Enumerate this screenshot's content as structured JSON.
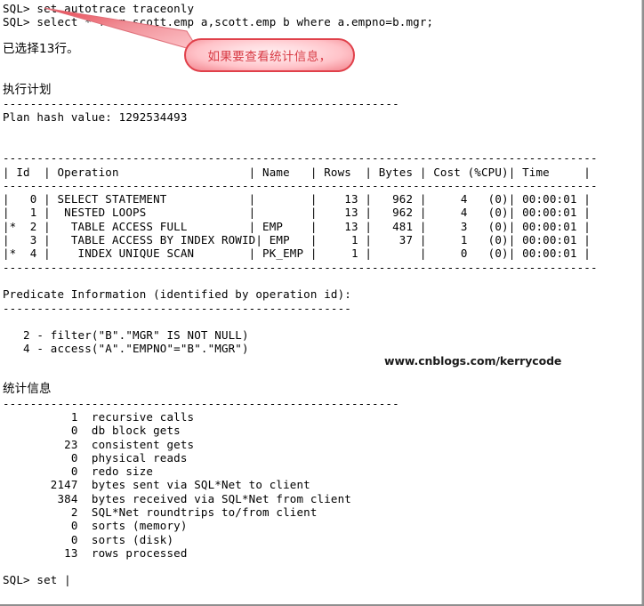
{
  "terminal": {
    "prompt": "SQL>",
    "lines": [
      {
        "type": "text",
        "text": "SQL> set autotrace traceonly"
      },
      {
        "type": "text",
        "text": "SQL> select * from scott.emp a,scott.emp b where a.empno=b.mgr;"
      },
      {
        "type": "blank",
        "text": ""
      },
      {
        "type": "cn",
        "text": "已选择13行。"
      },
      {
        "type": "blank",
        "text": ""
      },
      {
        "type": "blank",
        "text": ""
      },
      {
        "type": "cn",
        "text": "执行计划"
      },
      {
        "type": "text",
        "text": "----------------------------------------------------------"
      },
      {
        "type": "text",
        "text": "Plan hash value: 1292534493"
      },
      {
        "type": "blank",
        "text": ""
      },
      {
        "type": "blank",
        "text": ""
      },
      {
        "type": "text",
        "text": "---------------------------------------------------------------------------------------"
      },
      {
        "type": "text",
        "text": "| Id  | Operation                   | Name   | Rows  | Bytes | Cost (%CPU)| Time     |"
      },
      {
        "type": "text",
        "text": "---------------------------------------------------------------------------------------"
      },
      {
        "type": "text",
        "text": "|   0 | SELECT STATEMENT            |        |    13 |   962 |     4   (0)| 00:00:01 |"
      },
      {
        "type": "text",
        "text": "|   1 |  NESTED LOOPS               |        |    13 |   962 |     4   (0)| 00:00:01 |"
      },
      {
        "type": "text",
        "text": "|*  2 |   TABLE ACCESS FULL         | EMP    |    13 |   481 |     3   (0)| 00:00:01 |"
      },
      {
        "type": "text",
        "text": "|   3 |   TABLE ACCESS BY INDEX ROWID| EMP   |     1 |    37 |     1   (0)| 00:00:01 |"
      },
      {
        "type": "text",
        "text": "|*  4 |    INDEX UNIQUE SCAN        | PK_EMP |     1 |       |     0   (0)| 00:00:01 |"
      },
      {
        "type": "text",
        "text": "---------------------------------------------------------------------------------------"
      },
      {
        "type": "blank",
        "text": ""
      },
      {
        "type": "text",
        "text": "Predicate Information (identified by operation id):"
      },
      {
        "type": "text",
        "text": "---------------------------------------------------"
      },
      {
        "type": "blank",
        "text": ""
      },
      {
        "type": "text",
        "text": "   2 - filter(\"B\".\"MGR\" IS NOT NULL)"
      },
      {
        "type": "text",
        "text": "   4 - access(\"A\".\"EMPNO\"=\"B\".\"MGR\")"
      },
      {
        "type": "blank",
        "text": ""
      },
      {
        "type": "blank",
        "text": ""
      },
      {
        "type": "cn",
        "text": "统计信息"
      },
      {
        "type": "text",
        "text": "----------------------------------------------------------"
      },
      {
        "type": "text",
        "text": "          1  recursive calls"
      },
      {
        "type": "text",
        "text": "          0  db block gets"
      },
      {
        "type": "text",
        "text": "         23  consistent gets"
      },
      {
        "type": "text",
        "text": "          0  physical reads"
      },
      {
        "type": "text",
        "text": "          0  redo size"
      },
      {
        "type": "text",
        "text": "       2147  bytes sent via SQL*Net to client"
      },
      {
        "type": "text",
        "text": "        384  bytes received via SQL*Net from client"
      },
      {
        "type": "text",
        "text": "          2  SQL*Net roundtrips to/from client"
      },
      {
        "type": "text",
        "text": "          0  sorts (memory)"
      },
      {
        "type": "text",
        "text": "          0  sorts (disk)"
      },
      {
        "type": "text",
        "text": "         13  rows processed"
      },
      {
        "type": "blank",
        "text": ""
      },
      {
        "type": "text",
        "text": "SQL> set |"
      }
    ]
  },
  "plan": {
    "headers": [
      "Id",
      "Operation",
      "Name",
      "Rows",
      "Bytes",
      "Cost (%CPU)",
      "Time"
    ],
    "hash_value": "1292534493",
    "rows": [
      {
        "id": "0",
        "star": "",
        "operation": "SELECT STATEMENT",
        "name": "",
        "rows": "13",
        "bytes": "962",
        "cost": "4   (0)",
        "time": "00:00:01"
      },
      {
        "id": "1",
        "star": "",
        "operation": "NESTED LOOPS",
        "name": "",
        "rows": "13",
        "bytes": "962",
        "cost": "4   (0)",
        "time": "00:00:01"
      },
      {
        "id": "2",
        "star": "*",
        "operation": "TABLE ACCESS FULL",
        "name": "EMP",
        "rows": "13",
        "bytes": "481",
        "cost": "3   (0)",
        "time": "00:00:01"
      },
      {
        "id": "3",
        "star": "",
        "operation": "TABLE ACCESS BY INDEX ROWID",
        "name": "EMP",
        "rows": "1",
        "bytes": "37",
        "cost": "1   (0)",
        "time": "00:00:01"
      },
      {
        "id": "4",
        "star": "*",
        "operation": "INDEX UNIQUE SCAN",
        "name": "PK_EMP",
        "rows": "1",
        "bytes": "",
        "cost": "0   (0)",
        "time": "00:00:01"
      }
    ]
  },
  "predicates": {
    "title": "Predicate Information (identified by operation id):",
    "entries": [
      "2 - filter(\"B\".\"MGR\" IS NOT NULL)",
      "4 - access(\"A\".\"EMPNO\"=\"B\".\"MGR\")"
    ]
  },
  "statistics": {
    "title": "统计信息",
    "entries": [
      {
        "value": "1",
        "label": "recursive calls"
      },
      {
        "value": "0",
        "label": "db block gets"
      },
      {
        "value": "23",
        "label": "consistent gets"
      },
      {
        "value": "0",
        "label": "physical reads"
      },
      {
        "value": "0",
        "label": "redo size"
      },
      {
        "value": "2147",
        "label": "bytes sent via SQL*Net to client"
      },
      {
        "value": "384",
        "label": "bytes received via SQL*Net from client"
      },
      {
        "value": "2",
        "label": "SQL*Net roundtrips to/from client"
      },
      {
        "value": "0",
        "label": "sorts (memory)"
      },
      {
        "value": "0",
        "label": "sorts (disk)"
      },
      {
        "value": "13",
        "label": "rows processed"
      }
    ]
  },
  "annotation": {
    "text": "如果要查看统计信息，",
    "border_color": "#e0404a",
    "text_color": "#d83a44",
    "fill_color": "#ffd7db"
  },
  "watermark": {
    "text": "www.cnblogs.com/kerrycode"
  }
}
